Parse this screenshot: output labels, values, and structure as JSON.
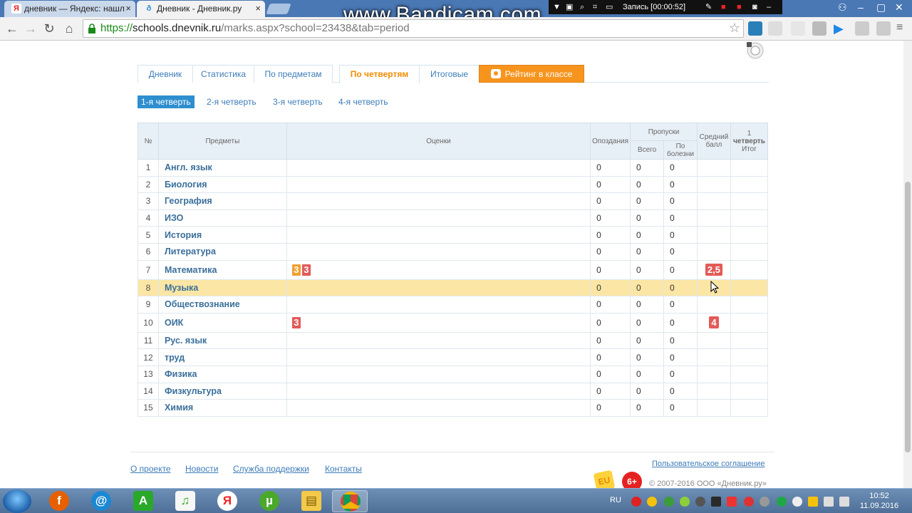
{
  "browser": {
    "tabs": [
      {
        "title": "дневник — Яндекс: нашл",
        "icon": "Я"
      },
      {
        "title": "Дневник - Дневник.ру",
        "icon": "ð"
      }
    ],
    "url": {
      "scheme": "https://",
      "host": "schools.dnevnik.ru",
      "path": "/marks.aspx?school=23438&tab=period"
    }
  },
  "recorder": {
    "watermark": "www.Bandicam.com",
    "status": "Запись [00:00:52]"
  },
  "nav": {
    "tabs": [
      {
        "label": "Дневник"
      },
      {
        "label": "Статистика"
      },
      {
        "label": "По предметам"
      },
      {
        "label": "По четвертям"
      },
      {
        "label": "Итоговые"
      },
      {
        "label": "Рейтинг в классе"
      }
    ],
    "active_tab": "По четвертям"
  },
  "quarters": [
    {
      "label": "1-я четверть"
    },
    {
      "label": "2-я четверть"
    },
    {
      "label": "3-я четверть"
    },
    {
      "label": "4-я четверть"
    }
  ],
  "table": {
    "headers": {
      "num": "№",
      "subjects": "Предметы",
      "marks": "Оценки",
      "late": "Опоздания",
      "absences": "Пропуски",
      "absences_total": "Всего",
      "absences_sick": "По болезни",
      "avg_line1": "Средний",
      "avg_line2": "балл",
      "final_line1": "1",
      "final_line2": "четверть",
      "final_line3": "Итог"
    },
    "rows": [
      {
        "num": "1",
        "subject": "Англ. язык",
        "marks": [],
        "late": "0",
        "total": "0",
        "sick": "0",
        "avg": ""
      },
      {
        "num": "2",
        "subject": "Биология",
        "marks": [],
        "late": "0",
        "total": "0",
        "sick": "0",
        "avg": ""
      },
      {
        "num": "3",
        "subject": "География",
        "marks": [],
        "late": "0",
        "total": "0",
        "sick": "0",
        "avg": ""
      },
      {
        "num": "4",
        "subject": "ИЗО",
        "marks": [],
        "late": "0",
        "total": "0",
        "sick": "0",
        "avg": ""
      },
      {
        "num": "5",
        "subject": "История",
        "marks": [],
        "late": "0",
        "total": "0",
        "sick": "0",
        "avg": ""
      },
      {
        "num": "6",
        "subject": "Литература",
        "marks": [],
        "late": "0",
        "total": "0",
        "sick": "0",
        "avg": ""
      },
      {
        "num": "7",
        "subject": "Математика",
        "marks": [
          {
            "value": "3",
            "color": "#f0a030"
          },
          {
            "value": "3",
            "color": "#e35a57"
          }
        ],
        "late": "0",
        "total": "0",
        "sick": "0",
        "avg": "2,5"
      },
      {
        "num": "8",
        "subject": "Музыка",
        "marks": [],
        "late": "0",
        "total": "0",
        "sick": "0",
        "avg": "",
        "highlighted": true
      },
      {
        "num": "9",
        "subject": "Обществознание",
        "marks": [],
        "late": "0",
        "total": "0",
        "sick": "0",
        "avg": ""
      },
      {
        "num": "10",
        "subject": "ОИК",
        "marks": [
          {
            "value": "3",
            "color": "#e35a57"
          }
        ],
        "late": "0",
        "total": "0",
        "sick": "0",
        "avg": "4"
      },
      {
        "num": "11",
        "subject": "Рус. язык",
        "marks": [],
        "late": "0",
        "total": "0",
        "sick": "0",
        "avg": ""
      },
      {
        "num": "12",
        "subject": "труд",
        "marks": [],
        "late": "0",
        "total": "0",
        "sick": "0",
        "avg": ""
      },
      {
        "num": "13",
        "subject": "Физика",
        "marks": [],
        "late": "0",
        "total": "0",
        "sick": "0",
        "avg": ""
      },
      {
        "num": "14",
        "subject": "Физкультура",
        "marks": [],
        "late": "0",
        "total": "0",
        "sick": "0",
        "avg": ""
      },
      {
        "num": "15",
        "subject": "Химия",
        "marks": [],
        "late": "0",
        "total": "0",
        "sick": "0",
        "avg": ""
      }
    ]
  },
  "footer": {
    "links": [
      "О проекте",
      "Новости",
      "Служба поддержки",
      "Контакты"
    ],
    "agreement": "Пользовательское соглашение",
    "copyright": "© 2007-2016 ООО «Дневник.ру»",
    "age_badge": "6+"
  },
  "taskbar": {
    "lang": "RU",
    "time": "10:52",
    "date": "11.09.2016",
    "apps": [
      "Firefox",
      "Почта",
      "Android",
      "Music",
      "Яндекс",
      "uTorrent",
      "Проводник",
      "Chrome"
    ]
  },
  "colors": {
    "link": "#3d7cb8",
    "accent_orange": "#f7941d",
    "active_quarter": "#2e8ecf",
    "mark_red": "#e35a57",
    "mark_orange": "#f0a030",
    "highlight_row": "#fbe6a5"
  }
}
